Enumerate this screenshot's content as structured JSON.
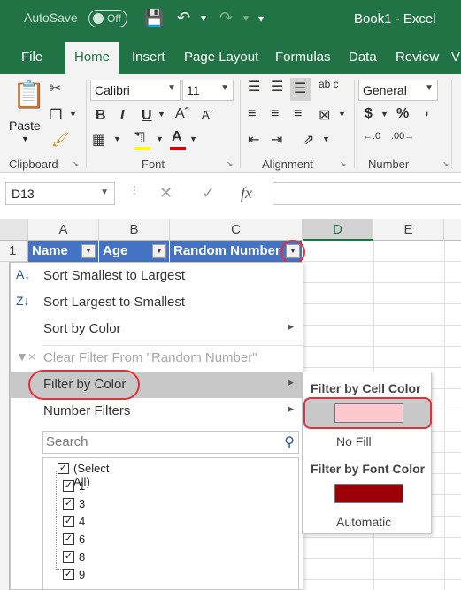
{
  "titlebar": {
    "autosave_label": "AutoSave",
    "autosave_state": "Off",
    "window_title": "Book1  -  Excel"
  },
  "tabs": [
    "File",
    "Home",
    "Insert",
    "Page Layout",
    "Formulas",
    "Data",
    "Review",
    "V"
  ],
  "active_tab": "Home",
  "ribbon": {
    "paste_label": "Paste",
    "font_name": "Calibri",
    "font_size": "11",
    "number_format": "General",
    "groups": [
      "Clipboard",
      "Font",
      "Alignment",
      "Number"
    ],
    "bold": "B",
    "italic": "I",
    "underline": "U",
    "dollar": "$",
    "percent": "%",
    "comma": ",",
    "wrap_icon": "ab c"
  },
  "formula_bar": {
    "name_box": "D13",
    "fx": "fx"
  },
  "columns": [
    "A",
    "B",
    "C",
    "D",
    "E"
  ],
  "selected_column": "D",
  "row1_number": "1",
  "headers": {
    "a": "Name",
    "b": "Age",
    "c": "Random Number"
  },
  "header_fill": "#4472c4",
  "filter_menu": {
    "sort_asc": "Sort Smallest to Largest",
    "sort_desc": "Sort Largest to Smallest",
    "sort_color": "Sort by Color",
    "clear_filter": "Clear Filter From \"Random Number\"",
    "filter_color": "Filter by Color",
    "number_filters": "Number Filters",
    "search_placeholder": "Search",
    "values": [
      "(Select All)",
      "1",
      "3",
      "4",
      "6",
      "8",
      "9"
    ]
  },
  "color_submenu": {
    "cell_color_heading": "Filter by Cell Color",
    "cell_color_swatch": "#ffc7ce",
    "no_fill": "No Fill",
    "font_color_heading": "Filter by Font Color",
    "font_color_swatch": "#9c0006",
    "automatic": "Automatic"
  },
  "highlight_color": "#e0303c",
  "theme_color": "#217346"
}
